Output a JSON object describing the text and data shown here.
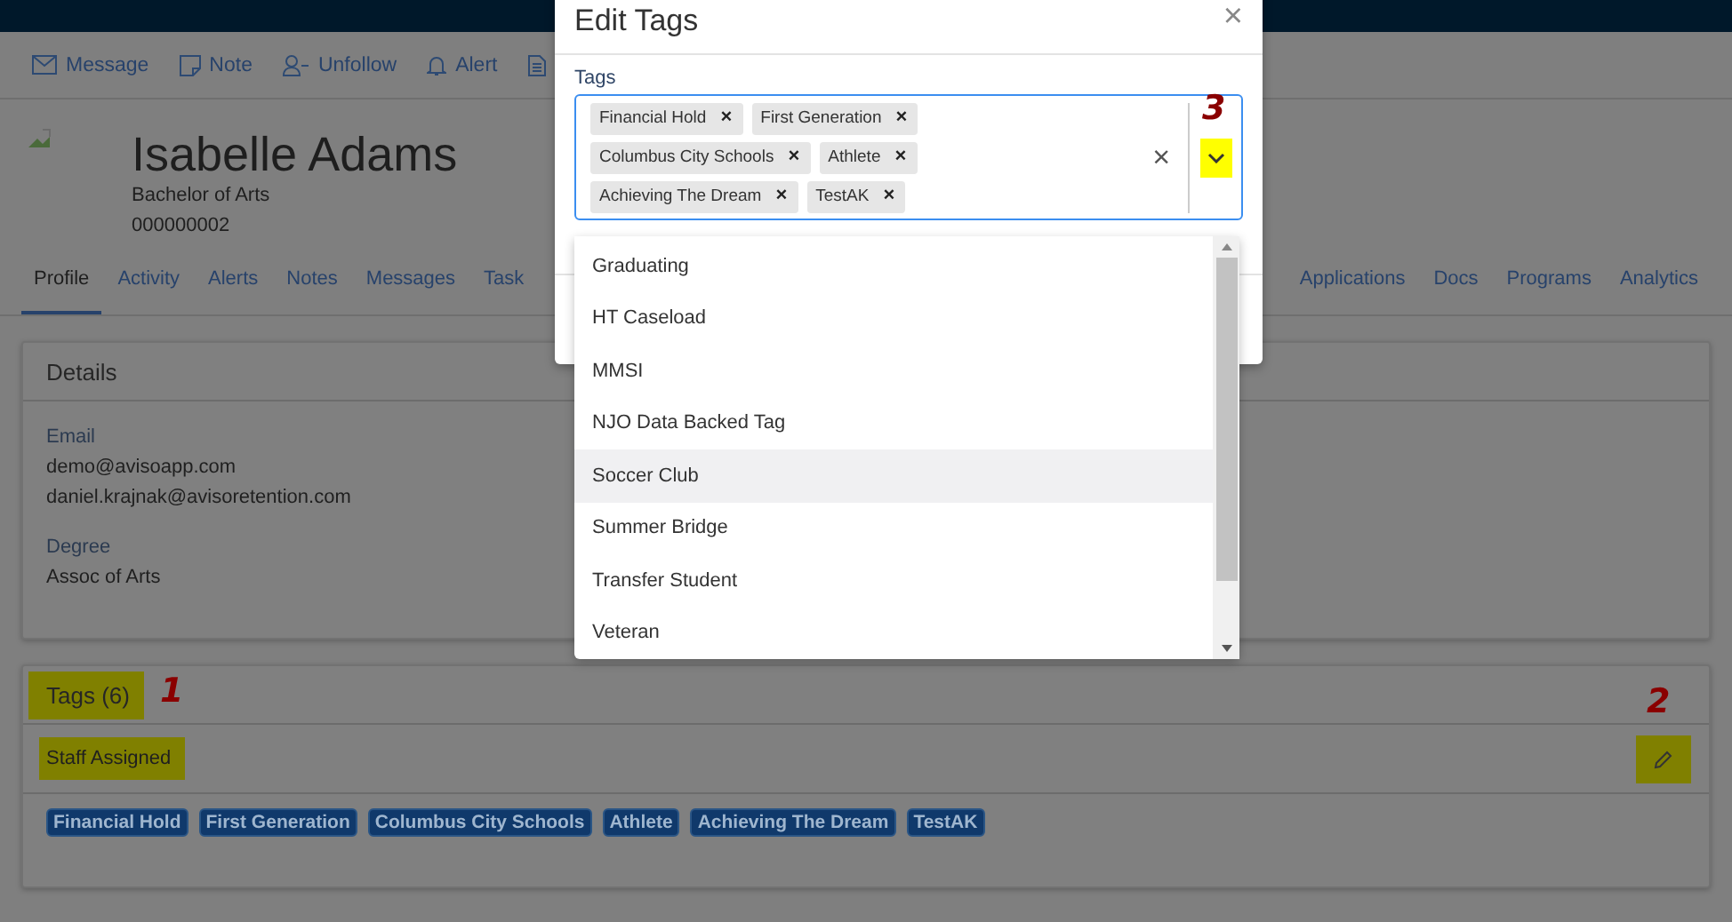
{
  "actions": [
    {
      "label": "Message"
    },
    {
      "label": "Note"
    },
    {
      "label": "Unfollow"
    },
    {
      "label": "Alert"
    }
  ],
  "profile": {
    "name": "Isabelle Adams",
    "degree": "Bachelor of Arts",
    "id": "000000002"
  },
  "tabs_left": [
    {
      "label": "Profile",
      "selected": true
    },
    {
      "label": "Activity",
      "selected": false
    },
    {
      "label": "Alerts",
      "selected": false
    },
    {
      "label": "Notes",
      "selected": false
    },
    {
      "label": "Messages",
      "selected": false
    },
    {
      "label": "Task",
      "selected": false
    }
  ],
  "tabs_right": [
    {
      "label": "Applications",
      "selected": false
    },
    {
      "label": "Docs",
      "selected": false
    },
    {
      "label": "Programs",
      "selected": false
    },
    {
      "label": "Analytics",
      "selected": false
    }
  ],
  "details": {
    "title": "Details",
    "fields": [
      {
        "label": "Email",
        "values": [
          "demo@avisoapp.com",
          "daniel.krajnak@avisoretention.com"
        ]
      },
      {
        "label": "Degree",
        "values": [
          "Assoc of Arts"
        ]
      }
    ]
  },
  "tags_card": {
    "title": "Tags (6)",
    "title_highlighted": true,
    "group": "Staff Assigned",
    "group_highlighted": true,
    "edit_highlighted": true,
    "badges": [
      "Financial Hold",
      "First Generation",
      "Columbus City Schools",
      "Athlete",
      "Achieving The Dream",
      "TestAK"
    ]
  },
  "modal": {
    "title": "Edit Tags",
    "close": "×",
    "field_label": "Tags",
    "chips": [
      {
        "label": "Financial Hold",
        "remove": "×"
      },
      {
        "label": "First Generation",
        "remove": "×"
      },
      {
        "label": "Columbus City Schools",
        "remove": "×"
      },
      {
        "label": "Athlete",
        "remove": "×"
      },
      {
        "label": "Achieving The Dream",
        "remove": "×"
      },
      {
        "label": "TestAK",
        "remove": "×"
      }
    ],
    "clear": "×",
    "toggle_highlighted": true,
    "options": [
      {
        "label": "Graduating",
        "focused": false
      },
      {
        "label": "HT Caseload",
        "focused": false
      },
      {
        "label": "MMSI",
        "focused": false
      },
      {
        "label": "NJO Data Backed Tag",
        "focused": false
      },
      {
        "label": "Soccer Club",
        "focused": true
      },
      {
        "label": "Summer Bridge",
        "focused": false
      },
      {
        "label": "Transfer Student",
        "focused": false
      },
      {
        "label": "Veteran",
        "focused": false
      }
    ]
  },
  "annotations": [
    {
      "label": "1"
    },
    {
      "label": "2"
    },
    {
      "label": "3"
    }
  ]
}
